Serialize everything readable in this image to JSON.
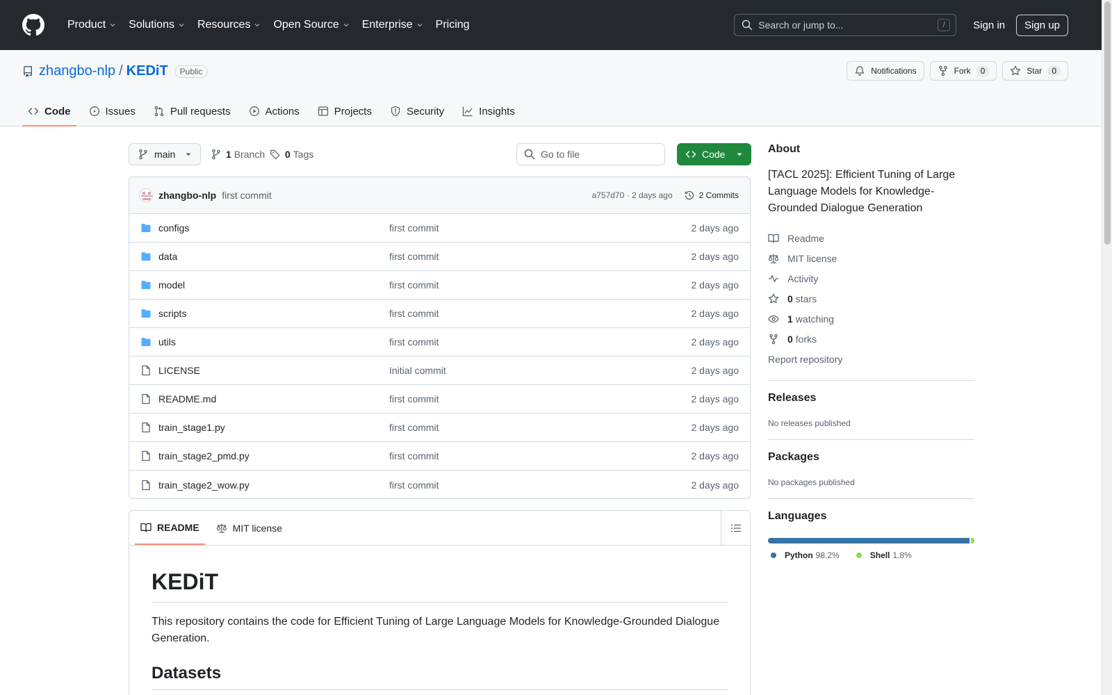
{
  "header": {
    "nav": [
      {
        "label": "Product",
        "has_menu": true
      },
      {
        "label": "Solutions",
        "has_menu": true
      },
      {
        "label": "Resources",
        "has_menu": true
      },
      {
        "label": "Open Source",
        "has_menu": true
      },
      {
        "label": "Enterprise",
        "has_menu": true
      },
      {
        "label": "Pricing",
        "has_menu": false
      }
    ],
    "search_placeholder": "Search or jump to...",
    "search_shortcut": "/",
    "signin": "Sign in",
    "signup": "Sign up"
  },
  "repo": {
    "owner": "zhangbo-nlp",
    "separator": "/",
    "name": "KEDiT",
    "visibility": "Public",
    "notifications_label": "Notifications",
    "fork_label": "Fork",
    "fork_count": "0",
    "star_label": "Star",
    "star_count": "0",
    "tabs": [
      {
        "label": "Code",
        "icon": "code-icon",
        "active": true
      },
      {
        "label": "Issues",
        "icon": "issue-icon",
        "active": false
      },
      {
        "label": "Pull requests",
        "icon": "pull-request-icon",
        "active": false
      },
      {
        "label": "Actions",
        "icon": "play-icon",
        "active": false
      },
      {
        "label": "Projects",
        "icon": "table-icon",
        "active": false
      },
      {
        "label": "Security",
        "icon": "shield-icon",
        "active": false
      },
      {
        "label": "Insights",
        "icon": "graph-icon",
        "active": false
      }
    ]
  },
  "toolbar": {
    "branch": "main",
    "branch_count": "1",
    "branch_label": "Branch",
    "tag_count": "0",
    "tag_label": "Tags",
    "goto_placeholder": "Go to file",
    "code_button": "Code"
  },
  "latest_commit": {
    "author": "zhangbo-nlp",
    "message": "first commit",
    "hash_time": "a757d70 · 2 days ago",
    "commits": "2 Commits"
  },
  "files": [
    {
      "name": "configs",
      "type": "dir",
      "message": "first commit",
      "date": "2 days ago"
    },
    {
      "name": "data",
      "type": "dir",
      "message": "first commit",
      "date": "2 days ago"
    },
    {
      "name": "model",
      "type": "dir",
      "message": "first commit",
      "date": "2 days ago"
    },
    {
      "name": "scripts",
      "type": "dir",
      "message": "first commit",
      "date": "2 days ago"
    },
    {
      "name": "utils",
      "type": "dir",
      "message": "first commit",
      "date": "2 days ago"
    },
    {
      "name": "LICENSE",
      "type": "file",
      "message": "Initial commit",
      "date": "2 days ago"
    },
    {
      "name": "README.md",
      "type": "file",
      "message": "first commit",
      "date": "2 days ago"
    },
    {
      "name": "train_stage1.py",
      "type": "file",
      "message": "first commit",
      "date": "2 days ago"
    },
    {
      "name": "train_stage2_pmd.py",
      "type": "file",
      "message": "first commit",
      "date": "2 days ago"
    },
    {
      "name": "train_stage2_wow.py",
      "type": "file",
      "message": "first commit",
      "date": "2 days ago"
    }
  ],
  "readme": {
    "tab_readme": "README",
    "tab_license": "MIT license",
    "title": "KEDiT",
    "intro": "This repository contains the code for Efficient Tuning of Large Language Models for Knowledge-Grounded Dialogue Generation.",
    "section": "Datasets"
  },
  "about": {
    "heading": "About",
    "description": "[TACL 2025]: Efficient Tuning of Large Language Models for Knowledge-Grounded Dialogue Generation",
    "readme": "Readme",
    "license": "MIT license",
    "activity": "Activity",
    "stars_count": "0",
    "stars_label": "stars",
    "watching_count": "1",
    "watching_label": "watching",
    "forks_count": "0",
    "forks_label": "forks",
    "report": "Report repository"
  },
  "releases": {
    "heading": "Releases",
    "empty": "No releases published"
  },
  "packages": {
    "heading": "Packages",
    "empty": "No packages published"
  },
  "languages": {
    "heading": "Languages",
    "items": [
      {
        "name": "Python",
        "percent": "98.2%",
        "value": 98.2,
        "color": "#3572A5"
      },
      {
        "name": "Shell",
        "percent": "1.8%",
        "value": 1.8,
        "color": "#89e051"
      }
    ]
  },
  "colors": {
    "header_bg": "#25292e",
    "link": "#0969da",
    "primary_button": "#1f883d",
    "active_tab_underline": "#fd8c73",
    "folder": "#54aeff"
  }
}
